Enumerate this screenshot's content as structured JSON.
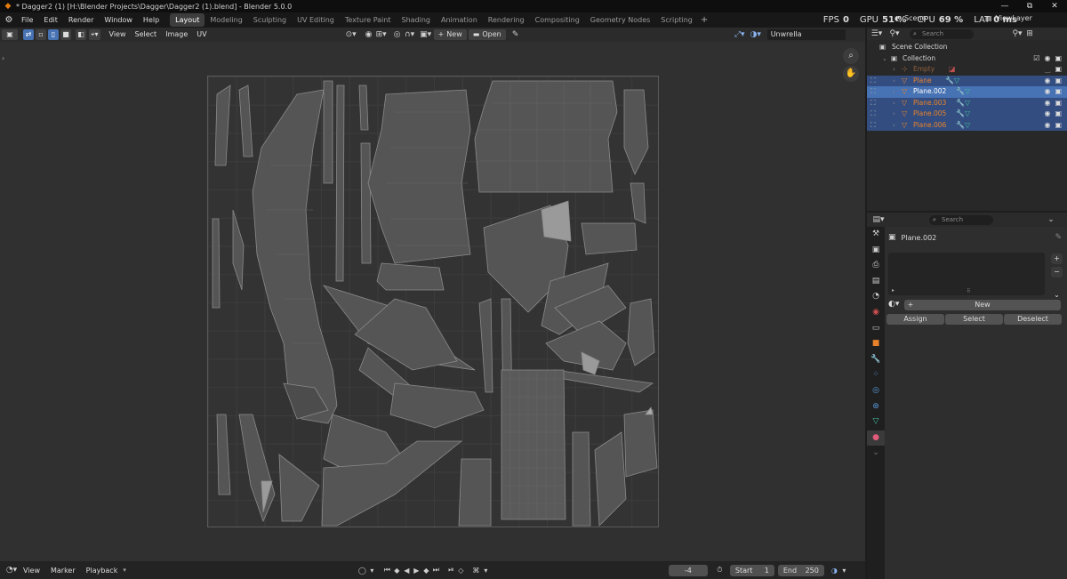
{
  "titlebar": {
    "title": "* Dagger2 (1) [H:\\Blender Projects\\Dagger\\Dagger2 (1).blend] - Blender 5.0.0",
    "minimize": "—",
    "maximize": "⧉",
    "close": "✕"
  },
  "menus": [
    "File",
    "Edit",
    "Render",
    "Window",
    "Help"
  ],
  "workspaces": [
    "Layout",
    "Modeling",
    "Sculpting",
    "UV Editing",
    "Texture Paint",
    "Shading",
    "Animation",
    "Rendering",
    "Compositing",
    "Geometry Nodes",
    "Scripting"
  ],
  "active_workspace": "Layout",
  "stats": {
    "fps_label": "FPS",
    "fps": "0",
    "gpu_label": "GPU",
    "gpu": "51 %",
    "cpu_label": "CPU",
    "cpu": "69 %",
    "lat_label": "LAT",
    "lat": "0 ms"
  },
  "scene": "Scene",
  "view_layer": "ViewLayer",
  "uv_header": {
    "menus": [
      "View",
      "Select",
      "Image",
      "UV"
    ],
    "new_label": "New",
    "open_label": "Open",
    "image_name": "Unwrella"
  },
  "timeline": {
    "menus": [
      "View",
      "Marker",
      "Playback"
    ],
    "current_frame": "-4",
    "start_label": "Start",
    "start": "1",
    "end_label": "End",
    "end": "250"
  },
  "outliner": {
    "search_placeholder": "Search",
    "root": "Scene Collection",
    "collection": "Collection",
    "items": [
      {
        "name": "Empty",
        "state": "dim"
      },
      {
        "name": "Plane",
        "state": "selected"
      },
      {
        "name": "Plane.002",
        "state": "active"
      },
      {
        "name": "Plane.003",
        "state": "selected"
      },
      {
        "name": "Plane.005",
        "state": "selected"
      },
      {
        "name": "Plane.006",
        "state": "selected"
      }
    ]
  },
  "properties": {
    "search_placeholder": "Search",
    "object_name": "Plane.002",
    "new_label": "New",
    "assign_label": "Assign",
    "select_label": "Select",
    "deselect_label": "Deselect"
  },
  "colors": {
    "accent": "#4772b3",
    "object_orange": "#e8822b",
    "mesh_teal": "#4fb0c6"
  }
}
